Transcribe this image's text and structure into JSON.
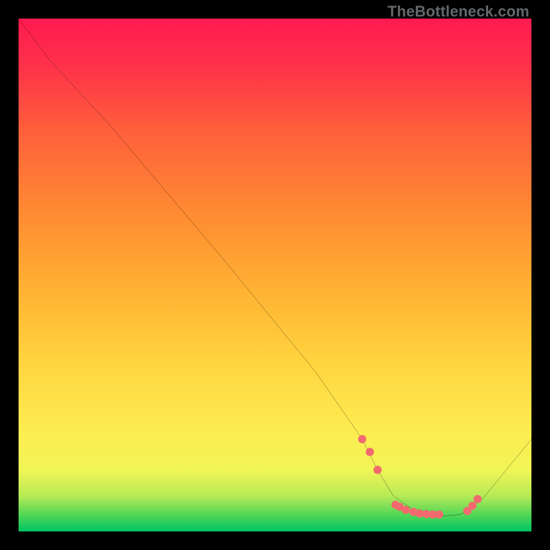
{
  "watermark": "TheBottleneck.com",
  "chart_data": {
    "type": "line",
    "title": "",
    "xlabel": "",
    "ylabel": "",
    "xlim": [
      0,
      100
    ],
    "ylim": [
      0,
      100
    ],
    "series": [
      {
        "name": "curve",
        "x": [
          0,
          6,
          18,
          40,
          58,
          67,
          70,
          73,
          78,
          83,
          86,
          88,
          91,
          100
        ],
        "y": [
          100,
          92,
          79,
          53,
          31,
          18,
          12,
          7,
          3.5,
          3,
          3.3,
          4.2,
          7,
          18
        ]
      }
    ],
    "markers": {
      "name": "dots",
      "color": "#f26a6e",
      "x": [
        67,
        68.5,
        70,
        73.5,
        74.3,
        75.5,
        77,
        78.2,
        79.5,
        80.8,
        82,
        87.5,
        88.5,
        89.5
      ],
      "y": [
        18,
        15.5,
        12,
        5.2,
        4.8,
        4.2,
        3.8,
        3.5,
        3.4,
        3.3,
        3.3,
        4,
        5,
        6.3
      ]
    },
    "background_gradient": {
      "top": "#ff1a51",
      "mid": "#ffd23a",
      "bottom": "#00c463"
    }
  }
}
